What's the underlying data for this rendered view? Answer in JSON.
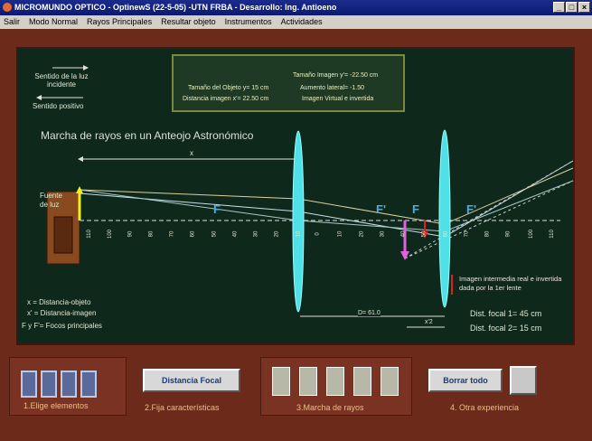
{
  "window": {
    "title": "MICROMUNDO OPTICO - OptinewS (22-5-05) -UTN FRBA - Desarrollo: Ing. Antioeno",
    "min": "_",
    "max": "□",
    "close": "×"
  },
  "menu": [
    "Salir",
    "Modo Normal",
    "Rayos Principales",
    "Resultar objeto",
    "Instrumentos",
    "Actividades"
  ],
  "legend": {
    "light_dir": "Sentido de la luz incidente",
    "positive_dir": "Sentido positivo"
  },
  "info": {
    "image_size": "Tamaño Imagen y'= -22.50 cm",
    "object_size": "Tamaño del Objeto y= 15 cm",
    "lateral_increase": "Aumento lateral= -1.50",
    "image_distance": "Distancia imagen x'= 22.50 cm",
    "image_type": "Imagen Virtual e invertida"
  },
  "diagram": {
    "title": "Marcha de rayos en un Anteojo Astronómico",
    "source": "Fuente de luz",
    "focus_labels": [
      "F",
      "F'",
      "F",
      "F'"
    ],
    "distance_label": "x",
    "axis_ticks": [
      "110",
      "100",
      "90",
      "80",
      "70",
      "60",
      "50",
      "40",
      "30",
      "20",
      "10",
      "0",
      "10",
      "20",
      "30",
      "40",
      "50",
      "60",
      "70",
      "80",
      "90",
      "100",
      "110"
    ],
    "d_label": "D= 61.0",
    "x2_label": "x'2",
    "intermediate": "Imagen intermedia real e invertida dada por la 1er lente",
    "def_x": "x = Distancia-objeto",
    "def_xp": "x' = Distancia-imagen",
    "def_f": "F y F'= Focos principales",
    "focal1": "Dist. focal 1= 45 cm",
    "focal2": "Dist. focal 2= 15 cm"
  },
  "bottom": {
    "step1": "1.Elige elementos",
    "step2": "2.Fija características",
    "step3": "3.Marcha de rayos",
    "step4": "4. Otra experiencia",
    "focal_button": "Distancia Focal",
    "clear_button": "Borrar todo"
  },
  "colors": {
    "board": "#0f281c",
    "lens": "#4fe0e8",
    "object": "#f0f020",
    "image": "#e060e0",
    "intermediate": "#e02020"
  }
}
